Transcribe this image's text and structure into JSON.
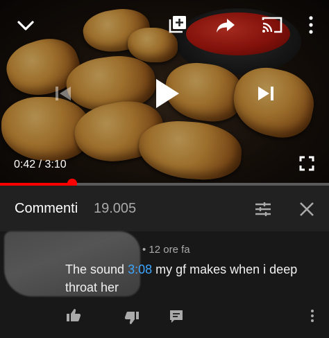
{
  "player": {
    "current_time": "0:42",
    "separator": " / ",
    "duration": "3:10",
    "progress": 0.22,
    "colors": {
      "progress": "#ff0000",
      "track": "#5a5a5a"
    },
    "icons": [
      "chevron-down-icon",
      "add-to-playlist-icon",
      "share-icon",
      "cast-icon",
      "more-vert-icon",
      "previous-icon",
      "play-icon",
      "next-icon",
      "fullscreen-icon"
    ]
  },
  "comments_header": {
    "title": "Commenti",
    "count": "19.005",
    "icons": [
      "sort-icon",
      "close-icon"
    ]
  },
  "comment": {
    "meta": "• 12 ore fa",
    "text_before": "The sound ",
    "timestamp_link": "3:08",
    "text_after": " my gf makes when i deep throat her",
    "link_color": "#3ea6ff",
    "actions": [
      "like-icon",
      "dislike-icon",
      "reply-icon",
      "more-vert-icon"
    ]
  }
}
